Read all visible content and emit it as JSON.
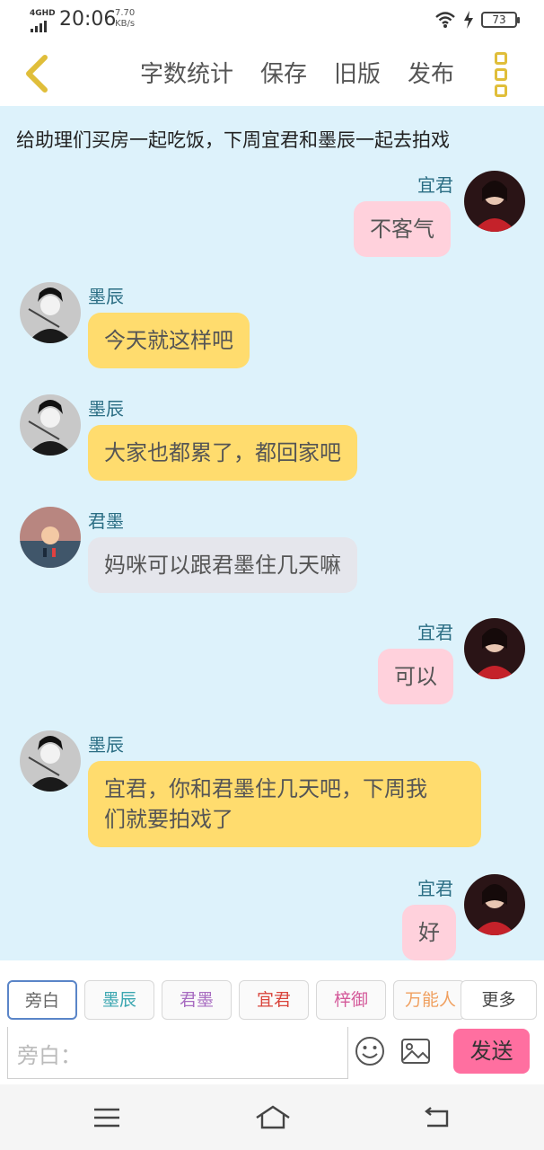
{
  "status_bar": {
    "network": "4GHD",
    "time": "20:06",
    "speed_value": "7.70",
    "speed_unit": "KB/s",
    "battery": "73"
  },
  "toolbar": {
    "word_count": "字数统计",
    "save": "保存",
    "old_version": "旧版",
    "publish": "发布"
  },
  "narration": "给助理们买房一起吃饭，下周宜君和墨辰一起去拍戏",
  "messages": [
    {
      "speaker": "宜君",
      "side": "right",
      "text": "不客气",
      "style": "pink"
    },
    {
      "speaker": "墨辰",
      "side": "left",
      "text": "今天就这样吧",
      "style": "yellow"
    },
    {
      "speaker": "墨辰",
      "side": "left",
      "text": "大家也都累了，都回家吧",
      "style": "yellow"
    },
    {
      "speaker": "君墨",
      "side": "left",
      "text": "妈咪可以跟君墨住几天嘛",
      "style": "gray"
    },
    {
      "speaker": "宜君",
      "side": "right",
      "text": "可以",
      "style": "pink"
    },
    {
      "speaker": "墨辰",
      "side": "left",
      "text_line1": "宜君，你和君墨住几天吧，下周我",
      "text_line2": "们就要拍戏了",
      "style": "yellow"
    },
    {
      "speaker": "宜君",
      "side": "right",
      "text": "好",
      "style": "pink"
    }
  ],
  "characters": [
    {
      "label": "旁白",
      "color": "#666666"
    },
    {
      "label": "墨辰",
      "color": "#3aa6b0"
    },
    {
      "label": "君墨",
      "color": "#a86cc1"
    },
    {
      "label": "宜君",
      "color": "#d9453c"
    },
    {
      "label": "梓御",
      "color": "#d45a9a"
    },
    {
      "label": "万能人",
      "color": "#f0a060"
    },
    {
      "label": "更多",
      "color": "#444444"
    }
  ],
  "input": {
    "placeholder": "旁白："
  },
  "send_label": "发送",
  "colors": {
    "chat_bg": "#ddf2fb",
    "pink_bubble": "#ffd1dc",
    "yellow_bubble": "#ffdc6e",
    "gray_bubble": "#e5e6ec",
    "send_button": "#ff6fa0",
    "accent_yellow": "#e0be3a",
    "name_color": "#2b6e84"
  }
}
